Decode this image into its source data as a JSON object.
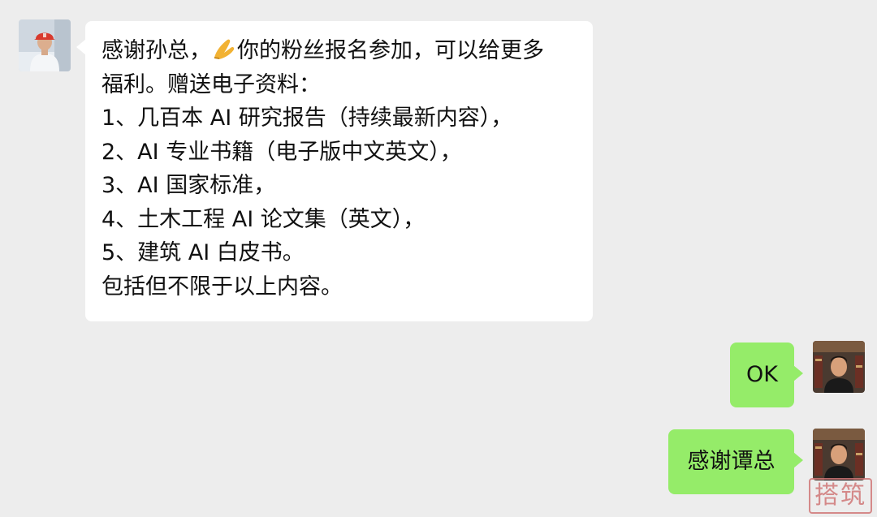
{
  "chat": {
    "incoming": {
      "lines": [
        {
          "before": "感谢孙总，",
          "emoji": "folded-hands-emoji",
          "after": "你的粉丝报名参加，可以给更多"
        },
        {
          "text": "福利。赠送电子资料："
        },
        {
          "text": "1、几百本 AI 研究报告（持续最新内容），"
        },
        {
          "text": "2、AI 专业书籍（电子版中文英文），"
        },
        {
          "text": "3、AI 国家标准，"
        },
        {
          "text": "4、土木工程 AI 论文集（英文），"
        },
        {
          "text": "5、建筑 AI 白皮书。"
        },
        {
          "text": "包括但不限于以上内容。"
        }
      ]
    },
    "outgoing": [
      {
        "text": "OK"
      },
      {
        "text": "感谢谭总"
      }
    ]
  },
  "colors": {
    "background": "#ededed",
    "incoming_bubble": "#ffffff",
    "outgoing_bubble": "#95ec69"
  },
  "watermark": {
    "text": "搭筑"
  }
}
